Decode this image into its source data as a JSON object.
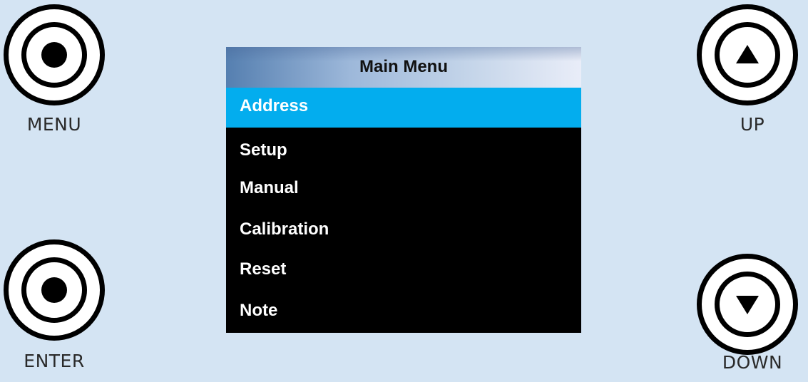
{
  "controls": {
    "menu_label": "MENU",
    "enter_label": "ENTER",
    "up_label": "UP",
    "down_label": "DOWN"
  },
  "screen": {
    "title": "Main Menu",
    "selected_index": 0,
    "items": [
      {
        "label": "Address"
      },
      {
        "label": "Setup"
      },
      {
        "label": "Manual"
      },
      {
        "label": "Calibration"
      },
      {
        "label": "Reset"
      },
      {
        "label": "Note"
      }
    ]
  },
  "colors": {
    "background": "#d4e4f3",
    "screen_background": "#000000",
    "selection_highlight": "#03adee",
    "menu_text": "#ffffff"
  }
}
